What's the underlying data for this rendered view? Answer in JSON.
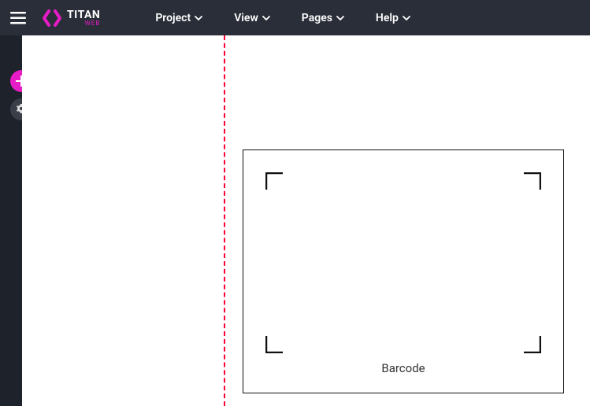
{
  "brand": {
    "title": "TITAN",
    "subtitle": "WEB"
  },
  "menu": [
    {
      "label": "Project"
    },
    {
      "label": "View"
    },
    {
      "label": "Pages"
    },
    {
      "label": "Help"
    }
  ],
  "sidebar": {
    "add_icon": "plus-icon",
    "settings_icon": "gear-icon"
  },
  "canvas": {
    "widget": {
      "label": "Barcode"
    }
  },
  "colors": {
    "accent": "#e61cc7",
    "dark": "#2a2e38",
    "darker": "#1e222b",
    "ruler": "#ff0033"
  }
}
